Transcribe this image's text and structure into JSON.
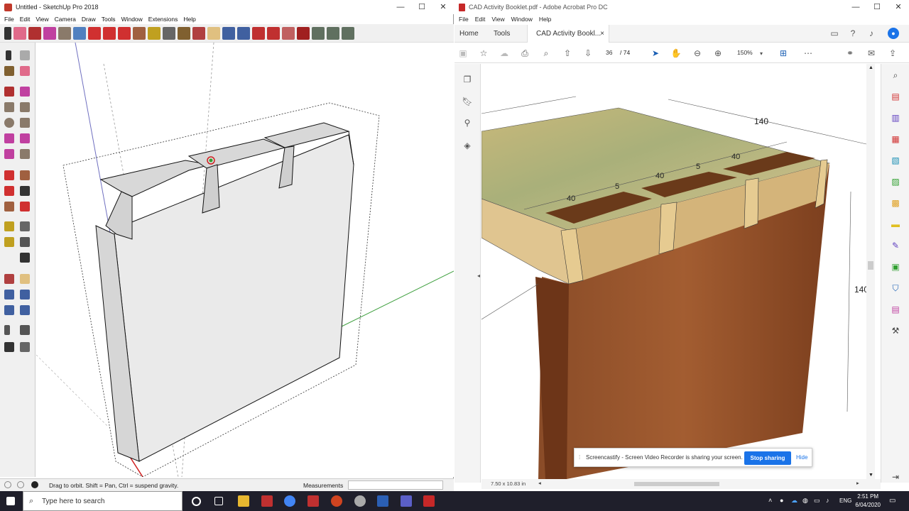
{
  "sketchup": {
    "title": "Untitled - SketchUp Pro 2018",
    "menu": [
      "File",
      "Edit",
      "View",
      "Camera",
      "Draw",
      "Tools",
      "Window",
      "Extensions",
      "Help"
    ],
    "status_hint": "Drag to orbit. Shift = Pan, Ctrl = suspend gravity.",
    "measurements_label": "Measurements",
    "window_controls": [
      "—",
      "☐",
      "✕"
    ]
  },
  "acrobat": {
    "title": "CAD Activity Booklet.pdf - Adobe Acrobat Pro DC",
    "menu": [
      "File",
      "Edit",
      "View",
      "Window",
      "Help"
    ],
    "tabs": {
      "home": "Home",
      "tools": "Tools",
      "document": "CAD Activity Bookl...",
      "close": "×"
    },
    "page_current": "36",
    "page_total": "/  74",
    "zoom": "150%",
    "page_size": "7.50 x 10.83 in",
    "dimension_labels": [
      "140",
      "140",
      "40",
      "40",
      "40",
      "5",
      "5"
    ],
    "window_controls": [
      "—",
      "☐",
      "✕"
    ]
  },
  "screencastify": {
    "message": "Screencastify - Screen Video Recorder is sharing your screen.",
    "stop_label": "Stop sharing",
    "hide_label": "Hide"
  },
  "taskbar": {
    "search_placeholder": "Type here to search",
    "language": "ENG",
    "time": "2:51 PM",
    "date": "6/04/2020"
  },
  "colors": {
    "su_red": "#c0392b",
    "acrobat_red": "#c62828",
    "stop_blue": "#1a73e8",
    "taskbar": "#1f1f2b"
  }
}
